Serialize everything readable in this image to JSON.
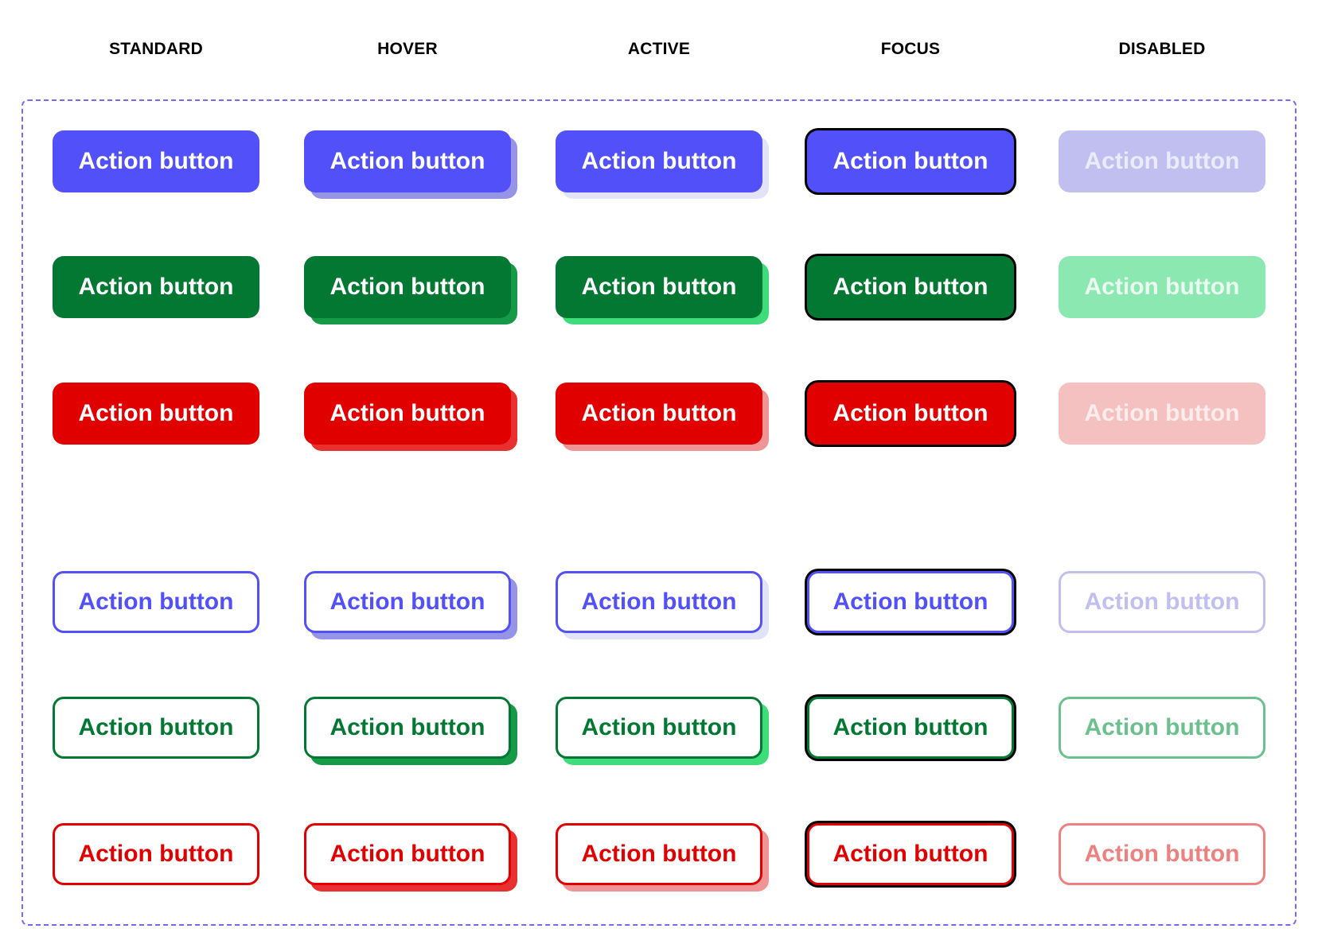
{
  "headers": [
    "STANDARD",
    "HOVER",
    "ACTIVE",
    "FOCUS",
    "DISABLED"
  ],
  "button_label": "Action button",
  "variants": [
    {
      "name": "primary-filled",
      "style": "filled",
      "color": "#5250f9",
      "text": "#ffffff",
      "hover_shadow": "#9594e6",
      "active_shadow": "#e2e2f8",
      "disabled_bg": "#c0bff0",
      "disabled_text": "#ebebfb"
    },
    {
      "name": "success-filled",
      "style": "filled",
      "color": "#037832",
      "text": "#ffffff",
      "hover_shadow": "#179a48",
      "active_shadow": "#3fdc7c",
      "disabled_bg": "#8be8b0",
      "disabled_text": "#eafaf0"
    },
    {
      "name": "danger-filled",
      "style": "filled",
      "color": "#e10000",
      "text": "#ffffff",
      "hover_shadow": "#e83030",
      "active_shadow": "#ef9595",
      "disabled_bg": "#f4c0c0",
      "disabled_text": "#fcecec"
    },
    {
      "name": "primary-outline",
      "style": "outline",
      "color": "#5250f9",
      "text": "#5250f9",
      "hover_shadow": "#9594e6",
      "active_shadow": "#e2e2f8",
      "disabled_bg": "#ffffff",
      "disabled_text": "#c0bff0"
    },
    {
      "name": "success-outline",
      "style": "outline",
      "color": "#037832",
      "text": "#037832",
      "hover_shadow": "#179a48",
      "active_shadow": "#3fdc7c",
      "disabled_bg": "#ffffff",
      "disabled_text": "#6cc08e"
    },
    {
      "name": "danger-outline",
      "style": "outline",
      "color": "#e10000",
      "text": "#e10000",
      "hover_shadow": "#e83030",
      "active_shadow": "#ef9595",
      "disabled_bg": "#ffffff",
      "disabled_text": "#ef8080"
    }
  ],
  "focus_ring_color": "#000000",
  "frame_border_color": "#7a66f0"
}
